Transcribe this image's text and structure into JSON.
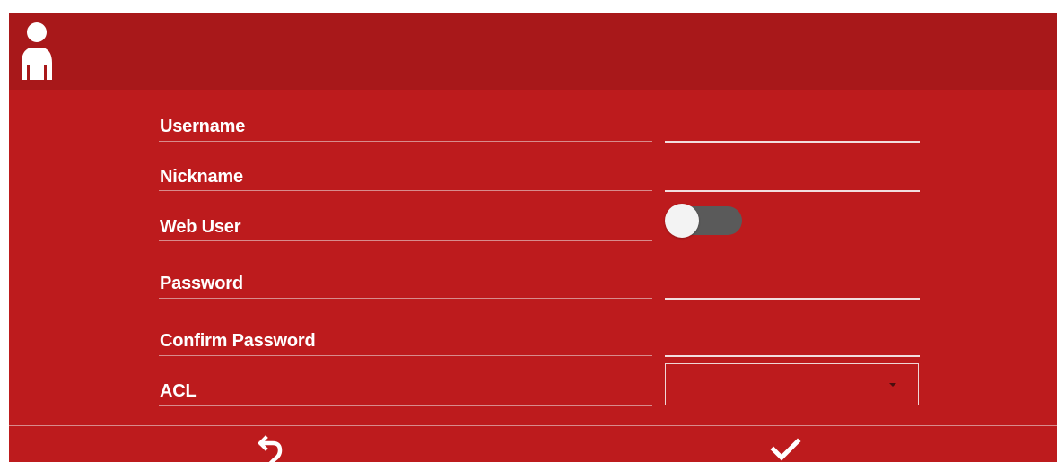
{
  "header": {
    "icon": "user-icon"
  },
  "form": {
    "fields": {
      "username": {
        "label": "Username",
        "value": "",
        "placeholder": ""
      },
      "nickname": {
        "label": "Nickname",
        "value": "",
        "placeholder": ""
      },
      "web_user": {
        "label": "Web User",
        "state": "off"
      },
      "password": {
        "label": "Password",
        "value": "",
        "placeholder": ""
      },
      "confirm_password": {
        "label": "Confirm Password",
        "value": "",
        "placeholder": ""
      },
      "acl": {
        "label": "ACL",
        "selected": ""
      }
    }
  },
  "footer": {
    "undo_icon": "undo-icon",
    "confirm_icon": "check-icon"
  },
  "colors": {
    "background": "#bd1b1d",
    "header": "#a8181a",
    "text": "#ffffff",
    "toggle_track": "#5a5a5a",
    "toggle_knob": "#f3f3f3"
  }
}
